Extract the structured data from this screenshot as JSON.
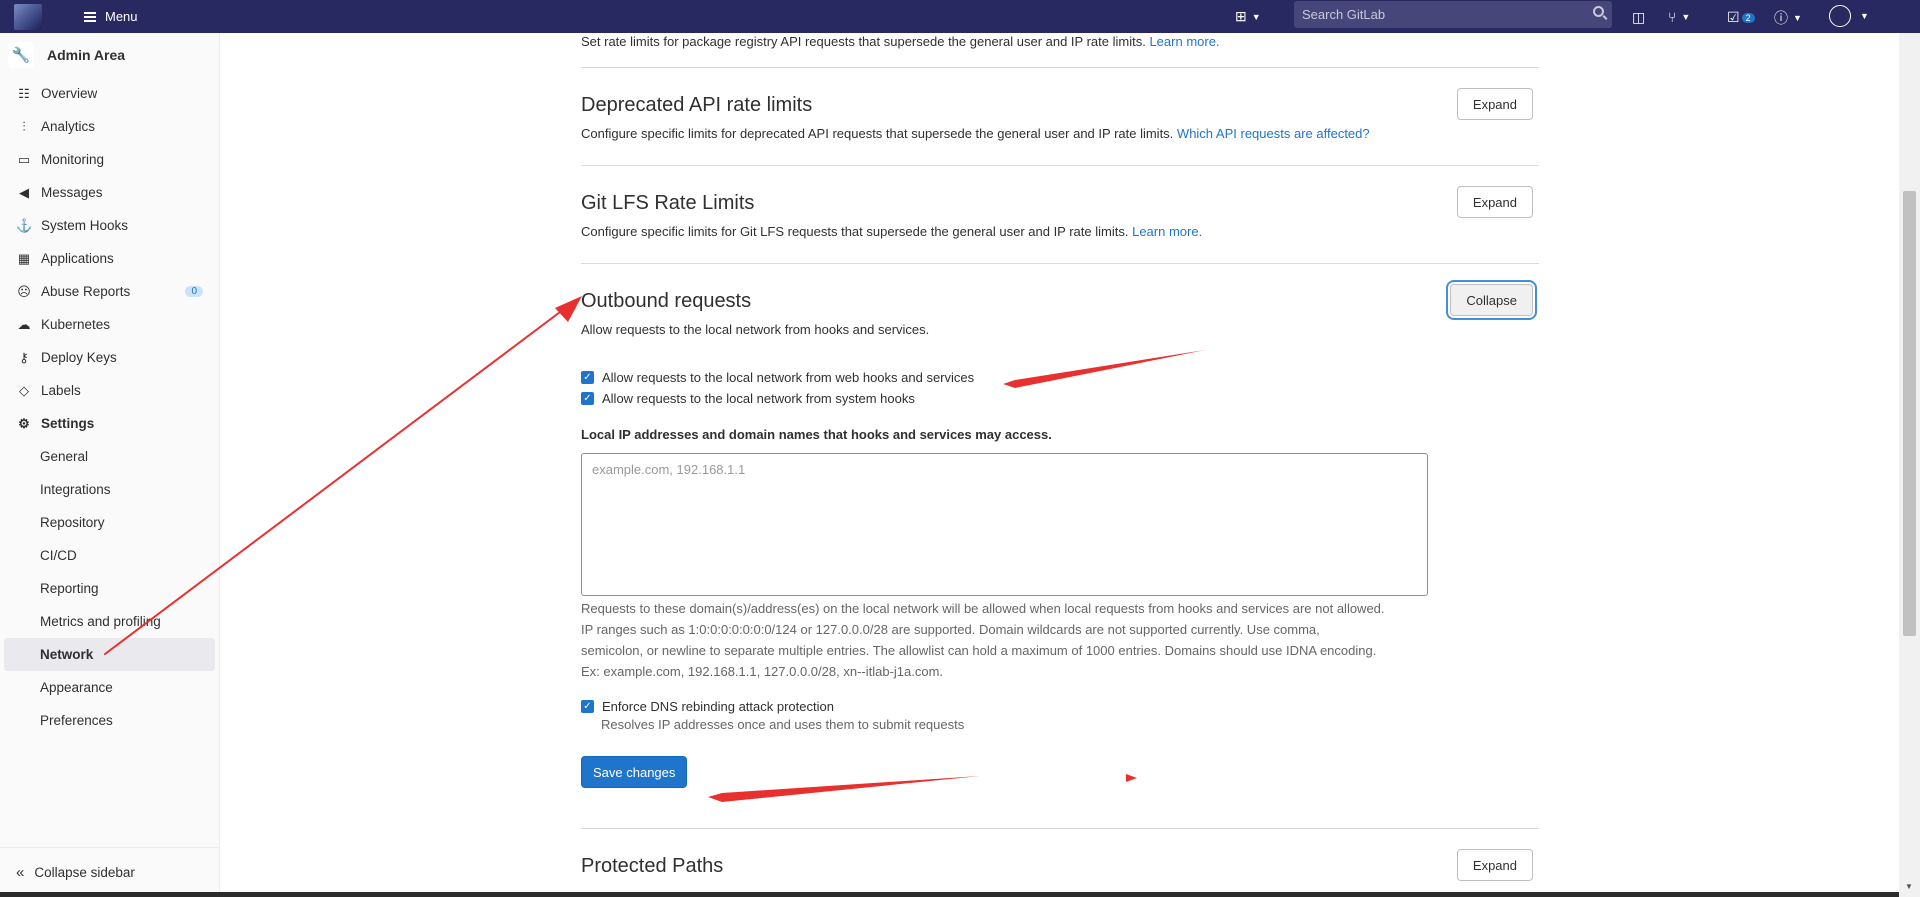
{
  "topbar": {
    "menu_label": "Menu",
    "search_placeholder": "Search GitLab",
    "todo_count": "2"
  },
  "sidebar": {
    "title": "Admin Area",
    "items": [
      {
        "label": "Overview",
        "icon": "overview-icon"
      },
      {
        "label": "Analytics",
        "icon": "analytics-icon"
      },
      {
        "label": "Monitoring",
        "icon": "monitoring-icon"
      },
      {
        "label": "Messages",
        "icon": "messages-icon"
      },
      {
        "label": "System Hooks",
        "icon": "hooks-icon"
      },
      {
        "label": "Applications",
        "icon": "applications-icon"
      },
      {
        "label": "Abuse Reports",
        "icon": "abuse-icon",
        "count": "0"
      },
      {
        "label": "Kubernetes",
        "icon": "kubernetes-icon"
      },
      {
        "label": "Deploy Keys",
        "icon": "key-icon"
      },
      {
        "label": "Labels",
        "icon": "label-icon"
      },
      {
        "label": "Settings",
        "icon": "settings-icon"
      }
    ],
    "settings_sub": [
      "General",
      "Integrations",
      "Repository",
      "CI/CD",
      "Reporting",
      "Metrics and profiling",
      "Network",
      "Appearance",
      "Preferences"
    ],
    "active_sub": "Network",
    "collapse_label": "Collapse sidebar"
  },
  "main": {
    "package_registry_desc": "Set rate limits for package registry API requests that supersede the general user and IP rate limits.",
    "package_registry_link": "Learn more.",
    "deprecated": {
      "title": "Deprecated API rate limits",
      "desc": "Configure specific limits for deprecated API requests that supersede the general user and IP rate limits.",
      "link": "Which API requests are affected?",
      "button": "Expand"
    },
    "git_lfs": {
      "title": "Git LFS Rate Limits",
      "desc": "Configure specific limits for Git LFS requests that supersede the general user and IP rate limits.",
      "link": "Learn more.",
      "button": "Expand"
    },
    "outbound": {
      "title": "Outbound requests",
      "desc": "Allow requests to the local network from hooks and services.",
      "button": "Collapse",
      "checkbox_webhooks": "Allow requests to the local network from web hooks and services",
      "checkbox_system_hooks": "Allow requests to the local network from system hooks",
      "allowlist_label": "Local IP addresses and domain names that hooks and services may access.",
      "allowlist_placeholder": "example.com, 192.168.1.1",
      "help_1": "Requests to these domain(s)/address(es) on the local network will be allowed when local requests from hooks and services are not allowed.",
      "help_2": "IP ranges such as 1:0:0:0:0:0:0:0/124 or 127.0.0.0/28 are supported. Domain wildcards are not supported currently. Use comma,",
      "help_3": "semicolon, or newline to separate multiple entries. The allowlist can hold a maximum of 1000 entries. Domains should use IDNA encoding.",
      "help_4": "Ex: example.com, 192.168.1.1, 127.0.0.0/28, xn--itlab-j1a.com.",
      "dns_checkbox": "Enforce DNS rebinding attack protection",
      "dns_help": "Resolves IP addresses once and uses them to submit requests",
      "save_button": "Save changes"
    },
    "protected_paths": {
      "title": "Protected Paths",
      "button": "Expand"
    }
  },
  "colors": {
    "navbar": "#292961",
    "accent": "#1f75cb",
    "annotation_arrow": "#e8312f"
  }
}
